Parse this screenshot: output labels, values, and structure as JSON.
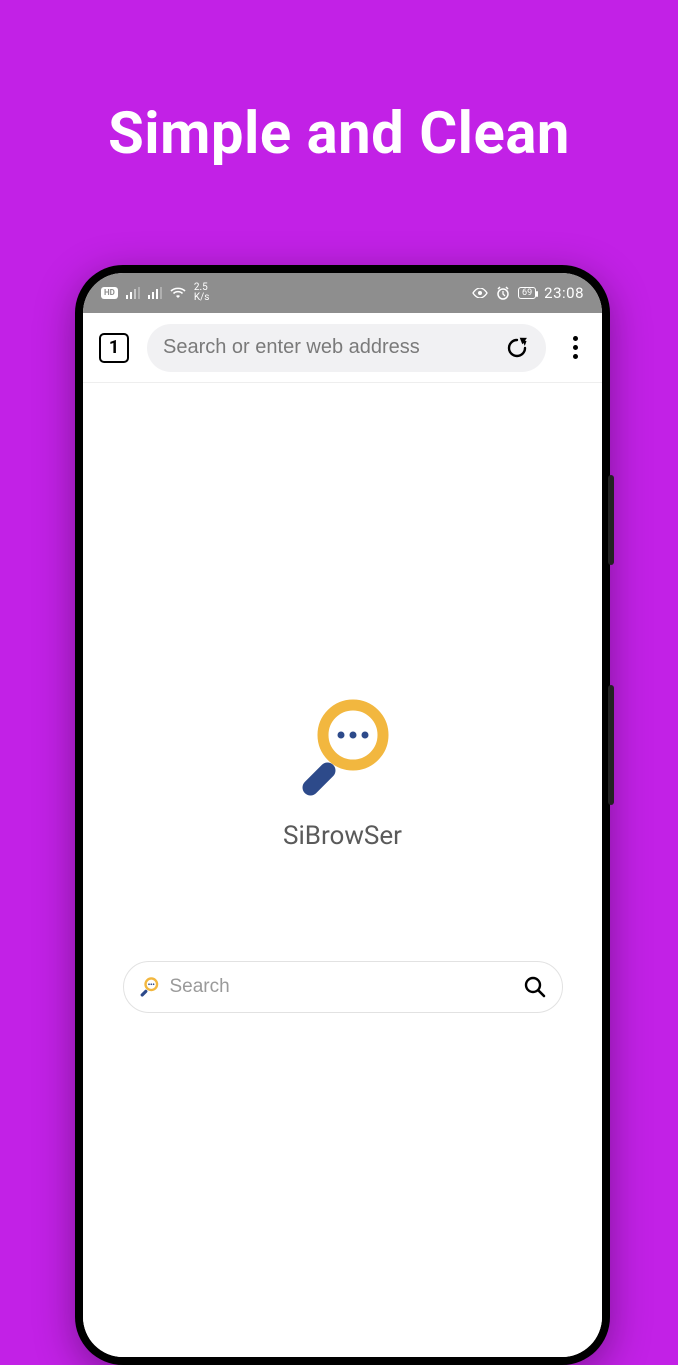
{
  "promo": {
    "title": "Simple and Clean"
  },
  "statusbar": {
    "hd_label": "HD",
    "net_speed_value": "2.5",
    "net_speed_unit": "K/s",
    "battery_percent": "69",
    "clock": "23:08"
  },
  "toolbar": {
    "tab_count": "1",
    "address_placeholder": "Search or enter web address"
  },
  "page": {
    "app_name": "SiBrowSer",
    "search_placeholder": "Search"
  },
  "colors": {
    "accent_purple": "#c221e6",
    "logo_ring": "#f2b73f",
    "logo_handle": "#2d4a8a",
    "logo_dots": "#2d4a8a"
  }
}
